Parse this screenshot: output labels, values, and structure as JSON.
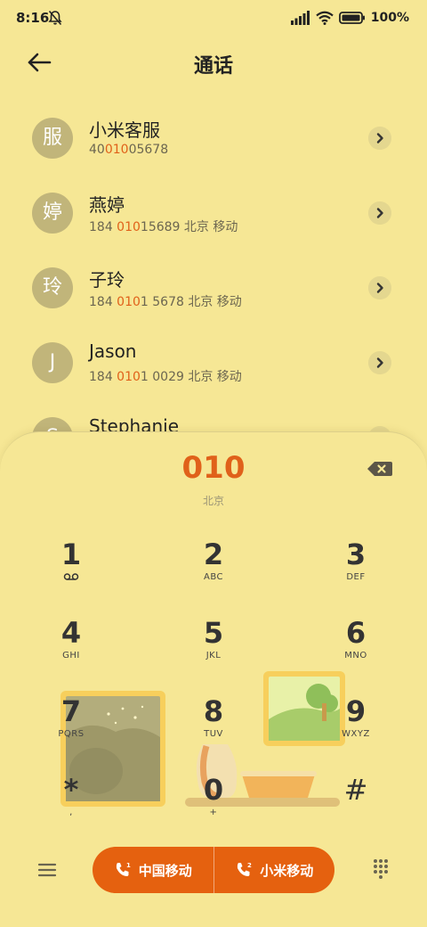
{
  "status_bar": {
    "time": "8:16",
    "battery": "100%"
  },
  "header": {
    "title": "通话"
  },
  "contacts": [
    {
      "initial": "服",
      "name": "小米客服",
      "num_pre": "40",
      "num_hl": "010",
      "num_post": "05678"
    },
    {
      "initial": "婷",
      "name": "燕婷",
      "num_pre": "184 ",
      "num_hl": "010",
      "num_post": "15689  北京 移动"
    },
    {
      "initial": "玲",
      "name": "子玲",
      "num_pre": "184 ",
      "num_hl": "010",
      "num_post": "1 5678  北京 移动"
    },
    {
      "initial": "J",
      "name": "Jason",
      "num_pre": "184 ",
      "num_hl": "010",
      "num_post": "1 0029  北京 移动"
    },
    {
      "initial": "S",
      "name": "Stephanie",
      "num_pre": "",
      "num_hl": "",
      "num_post": ""
    }
  ],
  "dialer": {
    "number": "010",
    "region": "北京",
    "keys": [
      {
        "num": "1",
        "sub": ""
      },
      {
        "num": "2",
        "sub": "ABC"
      },
      {
        "num": "3",
        "sub": "DEF"
      },
      {
        "num": "4",
        "sub": "GHI"
      },
      {
        "num": "5",
        "sub": "JKL"
      },
      {
        "num": "6",
        "sub": "MNO"
      },
      {
        "num": "7",
        "sub": "PQRS"
      },
      {
        "num": "8",
        "sub": "TUV"
      },
      {
        "num": "9",
        "sub": "WXYZ"
      },
      {
        "num": "*",
        "sub": ","
      },
      {
        "num": "0",
        "sub": "+"
      },
      {
        "num": "#",
        "sub": ""
      }
    ],
    "sim1_label": "中国移动",
    "sim2_label": "小米移动"
  },
  "icons": {
    "voicemail": "voicemail-icon",
    "delete": "backspace-icon",
    "menu": "menu-icon",
    "dialpad": "dialpad-icon",
    "back": "back-arrow-icon",
    "chevron": "chevron-right-icon",
    "call": "phone-sim-icon"
  },
  "colors": {
    "background": "#f6e795",
    "accent": "#e5610f",
    "highlight": "#e0611a",
    "avatar": "#c1b57a"
  }
}
